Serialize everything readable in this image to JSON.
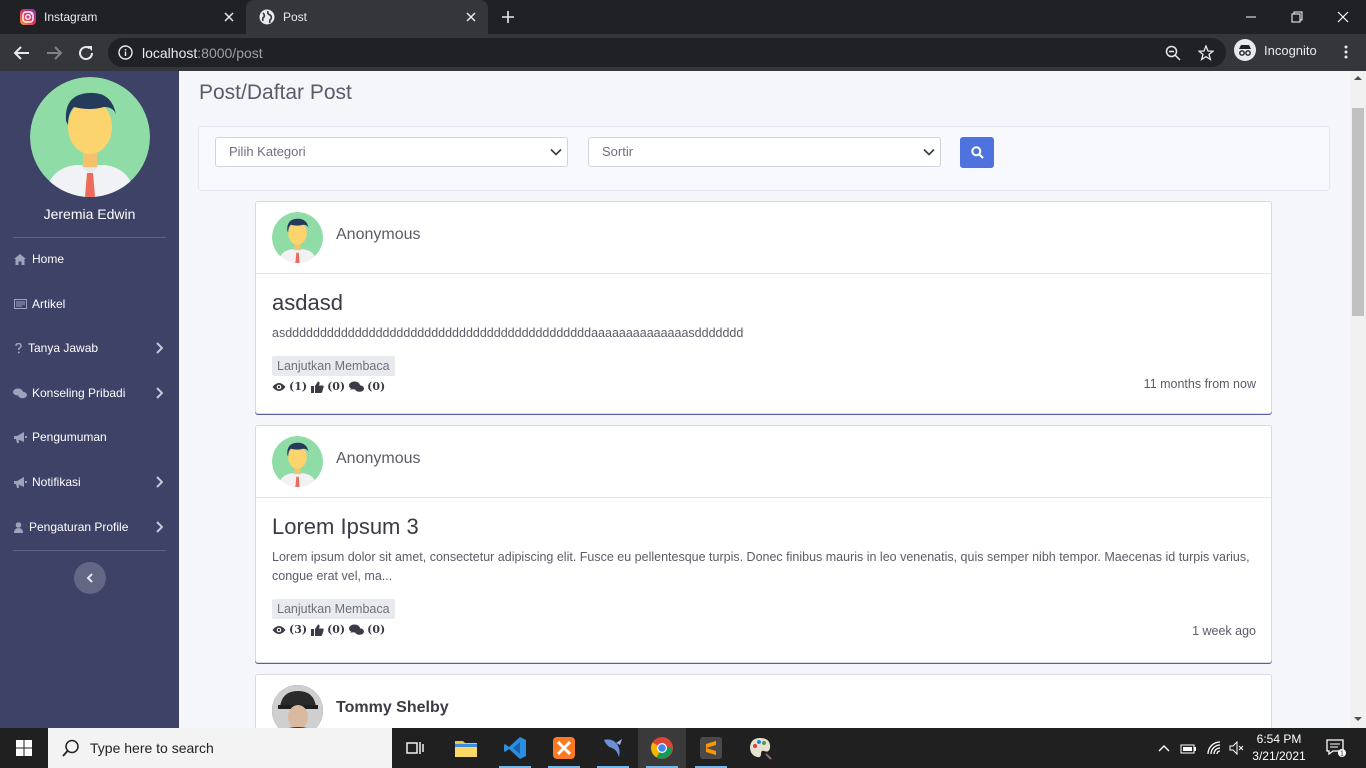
{
  "browser": {
    "tabs": [
      {
        "title": "Instagram",
        "icon": "instagram-icon"
      },
      {
        "title": "Post",
        "icon": "globe-icon"
      }
    ],
    "url_host": "localhost",
    "url_rest": ":8000/post",
    "profile_label": "Incognito"
  },
  "sidebar": {
    "user_name": "Jeremia Edwin",
    "items": [
      {
        "label": "Home",
        "icon": "home-icon",
        "has_children": false
      },
      {
        "label": "Artikel",
        "icon": "newspaper-icon",
        "has_children": false
      },
      {
        "label": "Tanya Jawab",
        "icon": "question-icon",
        "has_children": true
      },
      {
        "label": "Konseling Pribadi",
        "icon": "comments-icon",
        "has_children": true
      },
      {
        "label": "Pengumuman",
        "icon": "bullhorn-icon",
        "has_children": false
      },
      {
        "label": "Notifikasi",
        "icon": "bullhorn-icon",
        "has_children": true
      },
      {
        "label": "Pengaturan Profile",
        "icon": "user-icon",
        "has_children": true
      }
    ]
  },
  "page": {
    "title": "Post/Daftar Post",
    "filters": {
      "category_selected": "Pilih Kategori",
      "sort_selected": "Sortir"
    }
  },
  "posts": [
    {
      "author": "Anonymous",
      "title": "asdasd",
      "excerpt": "asddddddddddddddddddddddddddddddddddddddddddddaaaaaaaaaaaaaasddddddd",
      "read_more": "Lanjutkan Membaca",
      "views": "(1)",
      "likes": "(0)",
      "comments": "(0)",
      "time": "11 months from now"
    },
    {
      "author": "Anonymous",
      "title": "Lorem Ipsum 3",
      "excerpt": "Lorem ipsum dolor sit amet, consectetur adipiscing elit. Fusce eu pellentesque turpis. Donec finibus mauris in leo venenatis, quis semper nibh tempor. Maecenas id turpis varius, congue erat vel, ma...",
      "read_more": "Lanjutkan Membaca",
      "views": "(3)",
      "likes": "(0)",
      "comments": "(0)",
      "time": "1 week ago"
    },
    {
      "author": "Tommy Shelby"
    }
  ],
  "taskbar": {
    "search_placeholder": "Type here to search",
    "time": "6:54 PM",
    "date": "3/21/2021",
    "notification_count": "1"
  },
  "colors": {
    "sidebar": "#3d4266",
    "primary": "#4e73df",
    "avatar_bg": "#8fdca7"
  }
}
